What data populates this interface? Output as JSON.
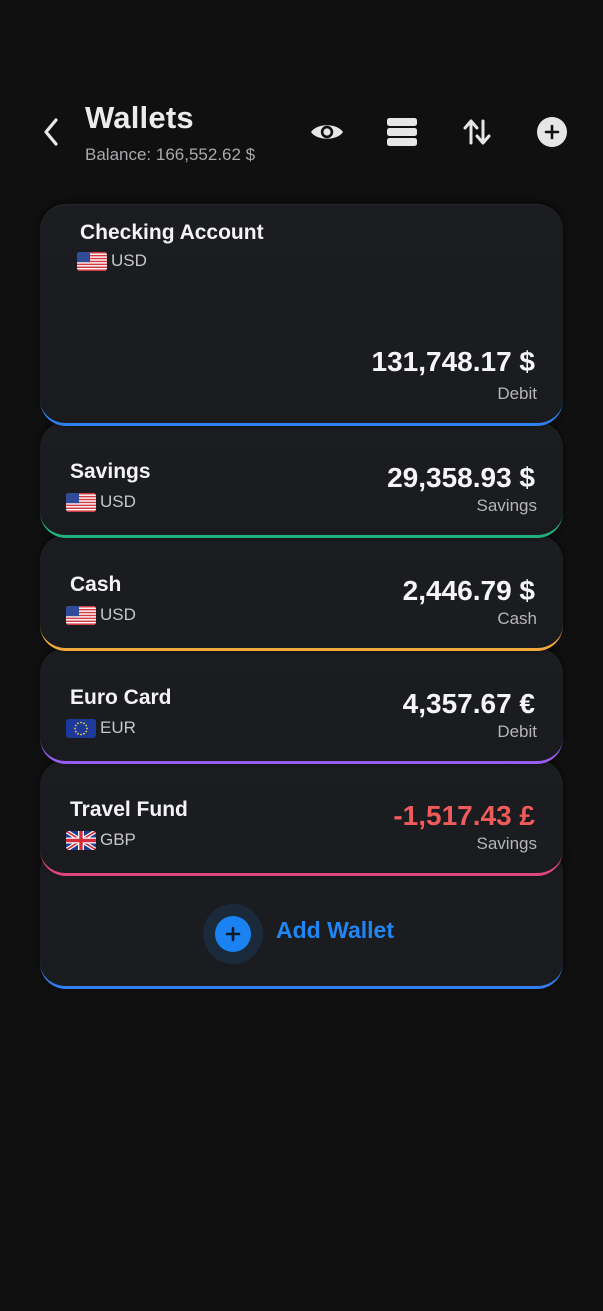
{
  "header": {
    "title": "Wallets",
    "balance": "Balance: 166,552.62 $",
    "icons": [
      "back-chevron-icon",
      "eye-icon",
      "stack-icon",
      "transfer-arrows-icon",
      "add-circle-icon"
    ]
  },
  "wallets": [
    {
      "name": "Checking Account",
      "currency": "USD",
      "amount": "131,748.17 $",
      "type": "Debit",
      "accent": "#2f80ed",
      "flag": "us-flag-icon"
    },
    {
      "name": "Savings",
      "currency": "USD",
      "amount": "29,358.93 $",
      "type": "Savings",
      "accent": "#22b07d",
      "flag": "us-flag-icon"
    },
    {
      "name": "Cash",
      "currency": "USD",
      "amount": "2,446.79 $",
      "type": "Cash",
      "accent": "#f2a93b",
      "flag": "us-flag-icon"
    },
    {
      "name": "Euro Card",
      "currency": "EUR",
      "amount": "4,357.67 €",
      "type": "Debit",
      "accent": "#9a5cf0",
      "flag": "eu-flag-icon"
    },
    {
      "name": "Travel Fund",
      "currency": "GBP",
      "amount": "-1,517.43 £",
      "type": "Savings",
      "accent": "#e0457b",
      "amount_color": "#ef5a5a",
      "flag": "uk-flag-icon"
    }
  ],
  "add_wallet": {
    "label": "Add Wallet",
    "accent": "#2f80ed"
  }
}
